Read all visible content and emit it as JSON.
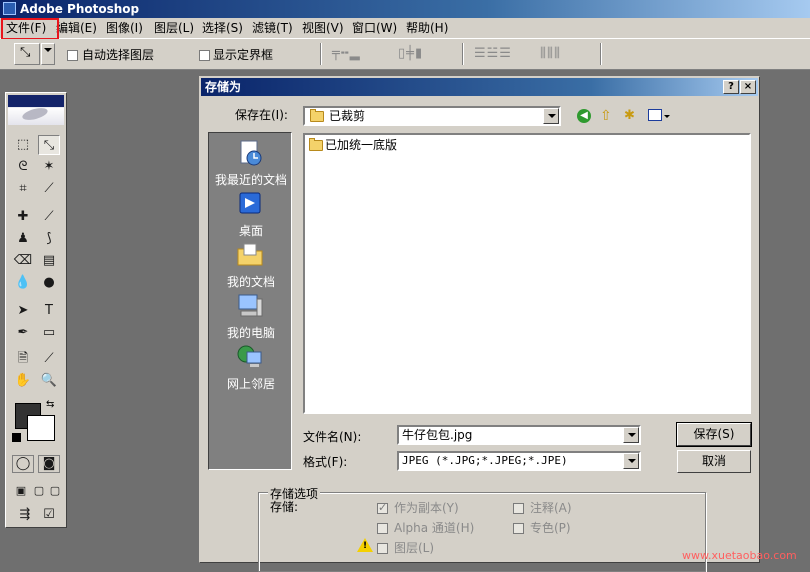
{
  "app": {
    "title": "Adobe Photoshop"
  },
  "menu": {
    "items": [
      "文件(F)",
      "编辑(E)",
      "图像(I)",
      "图层(L)",
      "选择(S)",
      "滤镜(T)",
      "视图(V)",
      "窗口(W)",
      "帮助(H)"
    ]
  },
  "options_bar": {
    "auto_select_layer": "自动选择图层",
    "show_bounding_box": "显示定界框"
  },
  "dialog": {
    "title": "存储为",
    "help_btn": "?",
    "close_btn": "×",
    "save_in_label": "保存在(I):",
    "save_in_value": "已裁剪",
    "places": [
      "我最近的文档",
      "桌面",
      "我的文档",
      "我的电脑",
      "网上邻居"
    ],
    "files": [
      "已加统一底版"
    ],
    "filename_label": "文件名(N):",
    "filename_value": "牛仔包包.jpg",
    "format_label": "格式(F):",
    "format_value": "JPEG (*.JPG;*.JPEG;*.JPE)",
    "save_button": "保存(S)",
    "cancel_button": "取消",
    "options_group": "存储选项",
    "save_label": "存储:",
    "opt_as_copy": "作为副本(Y)",
    "opt_alpha": "Alpha 通道(H)",
    "opt_layers": "图层(L)",
    "opt_annotations": "注释(A)",
    "opt_spot": "专色(P)"
  },
  "watermark": "www.xuetaobao.com",
  "colors": {
    "accent": "#e8141c",
    "titlebar": "#0a246a",
    "face": "#d4d0c8"
  }
}
